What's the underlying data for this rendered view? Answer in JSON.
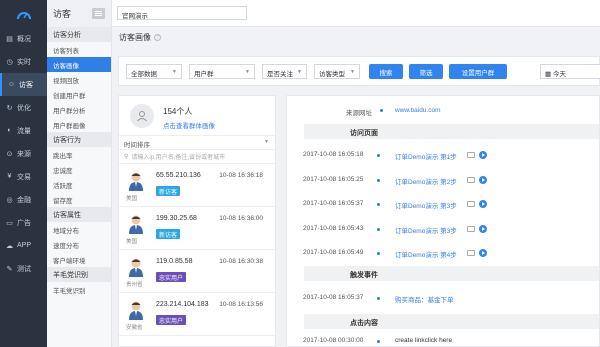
{
  "nav": {
    "items": [
      {
        "label": "概况",
        "icon": "overview-icon"
      },
      {
        "label": "实时",
        "icon": "realtime-icon"
      },
      {
        "label": "访客",
        "icon": "visitor-icon",
        "active": true
      },
      {
        "label": "优化",
        "icon": "optimize-icon"
      },
      {
        "label": "流量",
        "icon": "traffic-icon"
      },
      {
        "label": "来源",
        "icon": "source-icon"
      },
      {
        "label": "交易",
        "icon": "trade-icon"
      },
      {
        "label": "金融",
        "icon": "finance-icon"
      },
      {
        "label": "广告",
        "icon": "ad-icon"
      },
      {
        "label": "APP",
        "icon": "app-icon"
      },
      {
        "label": "测试",
        "icon": "test-icon"
      }
    ]
  },
  "sub": {
    "title": "访客",
    "groups": [
      {
        "label": "访客分析",
        "links": [
          "访客列表",
          "访客画像",
          "视频回放",
          "创建用户群",
          "用户群分析",
          "用户群画像"
        ]
      },
      {
        "label": "访客行为",
        "links": [
          "跳出率",
          "忠诚度",
          "活跃度",
          "留存度"
        ]
      },
      {
        "label": "访客属性",
        "links": [
          "地域分布",
          "速度分布",
          "客户端环境"
        ]
      },
      {
        "label": "羊毛党识别",
        "links": [
          "羊毛党识别"
        ]
      }
    ],
    "selected": "访客画像"
  },
  "topbar": {
    "site_select": "官网演示"
  },
  "page": {
    "title": "访客画像"
  },
  "filters": {
    "data_scope": "全部数据",
    "user_group": "用户群",
    "follow": "是否关注",
    "visitor_type": "访客类型",
    "search_btn": "搜索",
    "filter_btn": "筛选",
    "set_group_btn": "设置用户群",
    "date": "今天"
  },
  "visitors": {
    "count": "154个人",
    "view_group_link": "点击查看群体画像",
    "sort": "时间排序",
    "search_placeholder": "请输入ip,用户名,备注,省份或者城市",
    "rows": [
      {
        "ip": "65.55.210.136",
        "time": "10-08 16:36:18",
        "region": "美国",
        "tag": "新访客",
        "tag_type": "new"
      },
      {
        "ip": "199.30.25.68",
        "time": "10-08 16:36:00",
        "region": "美国",
        "tag": "新访客",
        "tag_type": "new"
      },
      {
        "ip": "119.0.85.58",
        "time": "10-08 16:30:38",
        "region": "贵州省",
        "tag": "忠实用户",
        "tag_type": "loyal"
      },
      {
        "ip": "223.214.104.183",
        "time": "10-08 16:13:56",
        "region": "安徽省",
        "tag": "忠实用户",
        "tag_type": "loyal"
      }
    ]
  },
  "detail": {
    "source_label": "来源网址",
    "source_value": "www.baidu.com",
    "sec_pages": "访问页面",
    "pages": [
      {
        "ts": "2017-10-08 16:05:18",
        "name": "订单Demo演示 第1步"
      },
      {
        "ts": "2017-10-08 16:05:25",
        "name": "订单Demo演示 第2步"
      },
      {
        "ts": "2017-10-08 16:05:37",
        "name": "订单Demo演示 第3步"
      },
      {
        "ts": "2017-10-08 16:05:43",
        "name": "订单Demo演示 第3步"
      },
      {
        "ts": "2017-10-08 16:05:49",
        "name": "订单Demo演示 第4步"
      }
    ],
    "sec_events": "触发事件",
    "events": [
      {
        "ts": "2017-10-08 16:05:37",
        "name": "购买商品：基金下单"
      }
    ],
    "sec_clicks": "点击内容",
    "clicks": [
      {
        "ts": "2017-10-08 00:30:00",
        "name": "create linkclick here"
      }
    ]
  }
}
